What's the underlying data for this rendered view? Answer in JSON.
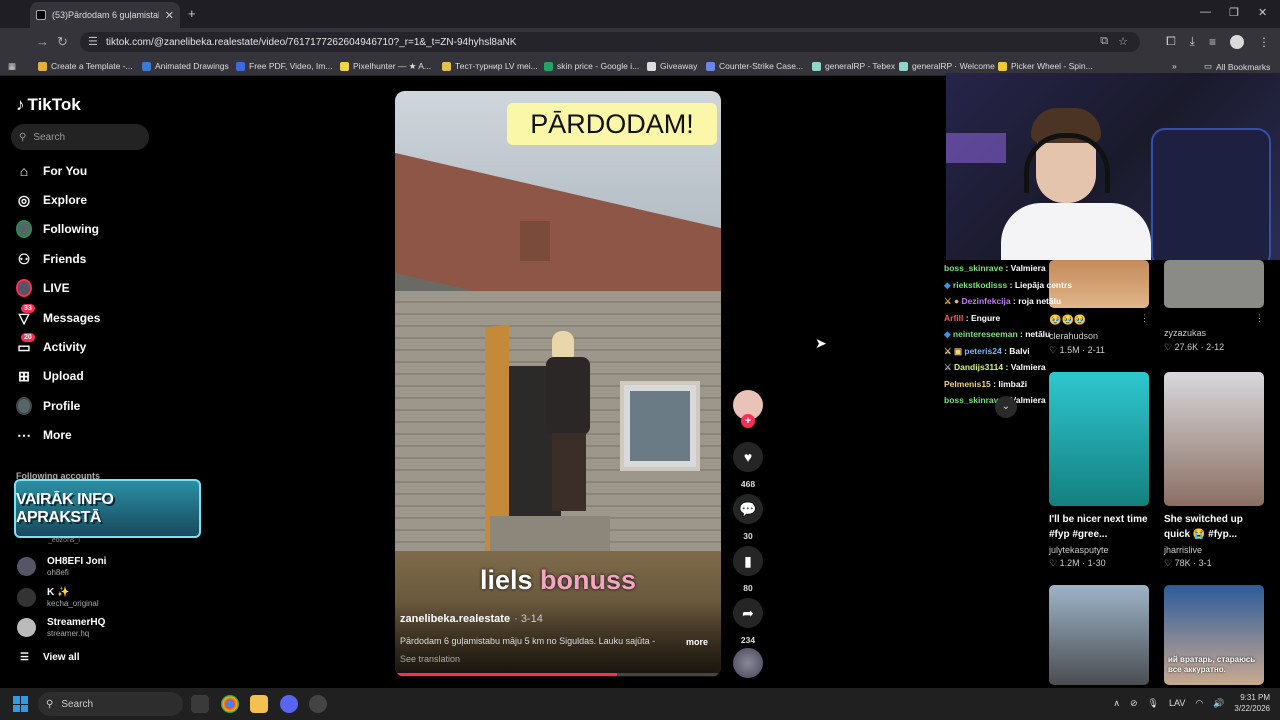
{
  "browser": {
    "tab_title": "(53)Pārdodam 6 guļamistabu m",
    "url": "tiktok.com/@zanelibeka.realestate/video/7617177262604946710?_r=1&_t=ZN-94hyhsl8aNK",
    "bookmarks": [
      {
        "label": "Create a Template -...",
        "color": "#e5b33b"
      },
      {
        "label": "Animated Drawings",
        "color": "#3a7bd5"
      },
      {
        "label": "Free PDF, Video, Im...",
        "color": "#3d6bdf"
      },
      {
        "label": "Pixelhunter — ★ A...",
        "color": "#f1d34a"
      },
      {
        "label": "Тест-турнир LV mei...",
        "color": "#e0c34a"
      },
      {
        "label": "skin price - Google i...",
        "color": "#1fa463"
      },
      {
        "label": "Giveaway",
        "color": "#dddddd"
      },
      {
        "label": "Counter-Strike Case...",
        "color": "#6a86e8"
      },
      {
        "label": "generalRP - Tebex",
        "color": "#8fd6c8"
      },
      {
        "label": "generalRP · Welcome",
        "color": "#8fd6c8"
      },
      {
        "label": "Picker Wheel - Spin...",
        "color": "#f0c93a"
      }
    ],
    "all_bookmarks": "All Bookmarks"
  },
  "sidebar": {
    "logo": "TikTok",
    "search_placeholder": "Search",
    "items": [
      {
        "label": "For You",
        "icon": "home-icon"
      },
      {
        "label": "Explore",
        "icon": "compass-icon"
      },
      {
        "label": "Following",
        "icon": "following-avatar-icon"
      },
      {
        "label": "Friends",
        "icon": "friends-icon"
      },
      {
        "label": "LIVE",
        "icon": "live-icon"
      },
      {
        "label": "Messages",
        "icon": "send-icon",
        "badge": "33"
      },
      {
        "label": "Activity",
        "icon": "inbox-icon",
        "badge": "20"
      },
      {
        "label": "Upload",
        "icon": "plus-square-icon"
      },
      {
        "label": "Profile",
        "icon": "profile-avatar-icon"
      },
      {
        "label": "More",
        "icon": "more-dots-icon"
      }
    ],
    "following_heading": "Following accounts",
    "overlay_banner": "VAIRĀK INFO APRAKSTĀ",
    "faded_handle": "_edzons_l",
    "accounts": [
      {
        "name": "OH8EFI Joni",
        "handle": "oh8efi"
      },
      {
        "name": "K ✨",
        "handle": "kecha_original"
      },
      {
        "name": "StreamerHQ",
        "handle": "streamer.hq"
      }
    ],
    "view_all": "View all"
  },
  "video": {
    "title_sticker": "PĀRDODAM!",
    "caption_word1": "liels",
    "caption_word2": "bonuss",
    "author": "zanelibeka.realestate",
    "date": "3-14",
    "description": "Pārdodam 6 guļamistabu māju 5 km no Siguldas. Lauku sajūta -",
    "more": "more",
    "see_translation": "See translation",
    "progress_percent": 68
  },
  "actions": {
    "likes": "468",
    "comments": "30",
    "saves": "80",
    "shares": "234"
  },
  "chat": [
    {
      "user": "boss_skinrave",
      "msg": "Valmiera",
      "color": "#7be37b"
    },
    {
      "user": "riekstkodisss",
      "msg": "Liepāja centrs",
      "color": "#7be37b"
    },
    {
      "user": "Dezinfekcija",
      "msg": "roja netālu",
      "color": "#c17bf2"
    },
    {
      "user": "Arfill",
      "msg": "Engure",
      "color": "#ff5a5a"
    },
    {
      "user": "neintereseeman",
      "msg": "netālu",
      "color": "#7be37b"
    },
    {
      "user": "peteris24",
      "msg": "Balvi",
      "color": "#7bb9f2"
    },
    {
      "user": "Dandijs3114",
      "msg": "Valmiera",
      "color": "#d6f27b"
    },
    {
      "user": "Pelmenis15",
      "msg": "limbaži",
      "color": "#f2d27b"
    },
    {
      "user": "boss_skinrave",
      "msg": "Valmiera",
      "color": "#7be37b"
    }
  ],
  "grid": [
    {
      "caption": "",
      "user": "clerahudson",
      "likes": "1.5M",
      "date": "2-11",
      "emoji": "🥹🥹🥹"
    },
    {
      "caption": "",
      "user": "zyzazukas",
      "likes": "27.6K",
      "date": "2-12"
    },
    {
      "caption": "I'll be nicer next time #fyp #gree...",
      "user": "julytekasputyte",
      "likes": "1.2M",
      "date": "1-30"
    },
    {
      "caption": "She switched up quick 😭 #fyp...",
      "user": "jharrislive",
      "likes": "78K",
      "date": "3-1"
    },
    {
      "overlay": "",
      "user": "",
      "likes": "",
      "date": ""
    },
    {
      "overlay": "ий вратарь, стараюсь все аккуратно.",
      "user": "",
      "likes": "",
      "date": ""
    }
  ],
  "taskbar": {
    "search": "Search",
    "lang": "LAV",
    "time": "9:31 PM",
    "date": "3/22/2026"
  }
}
